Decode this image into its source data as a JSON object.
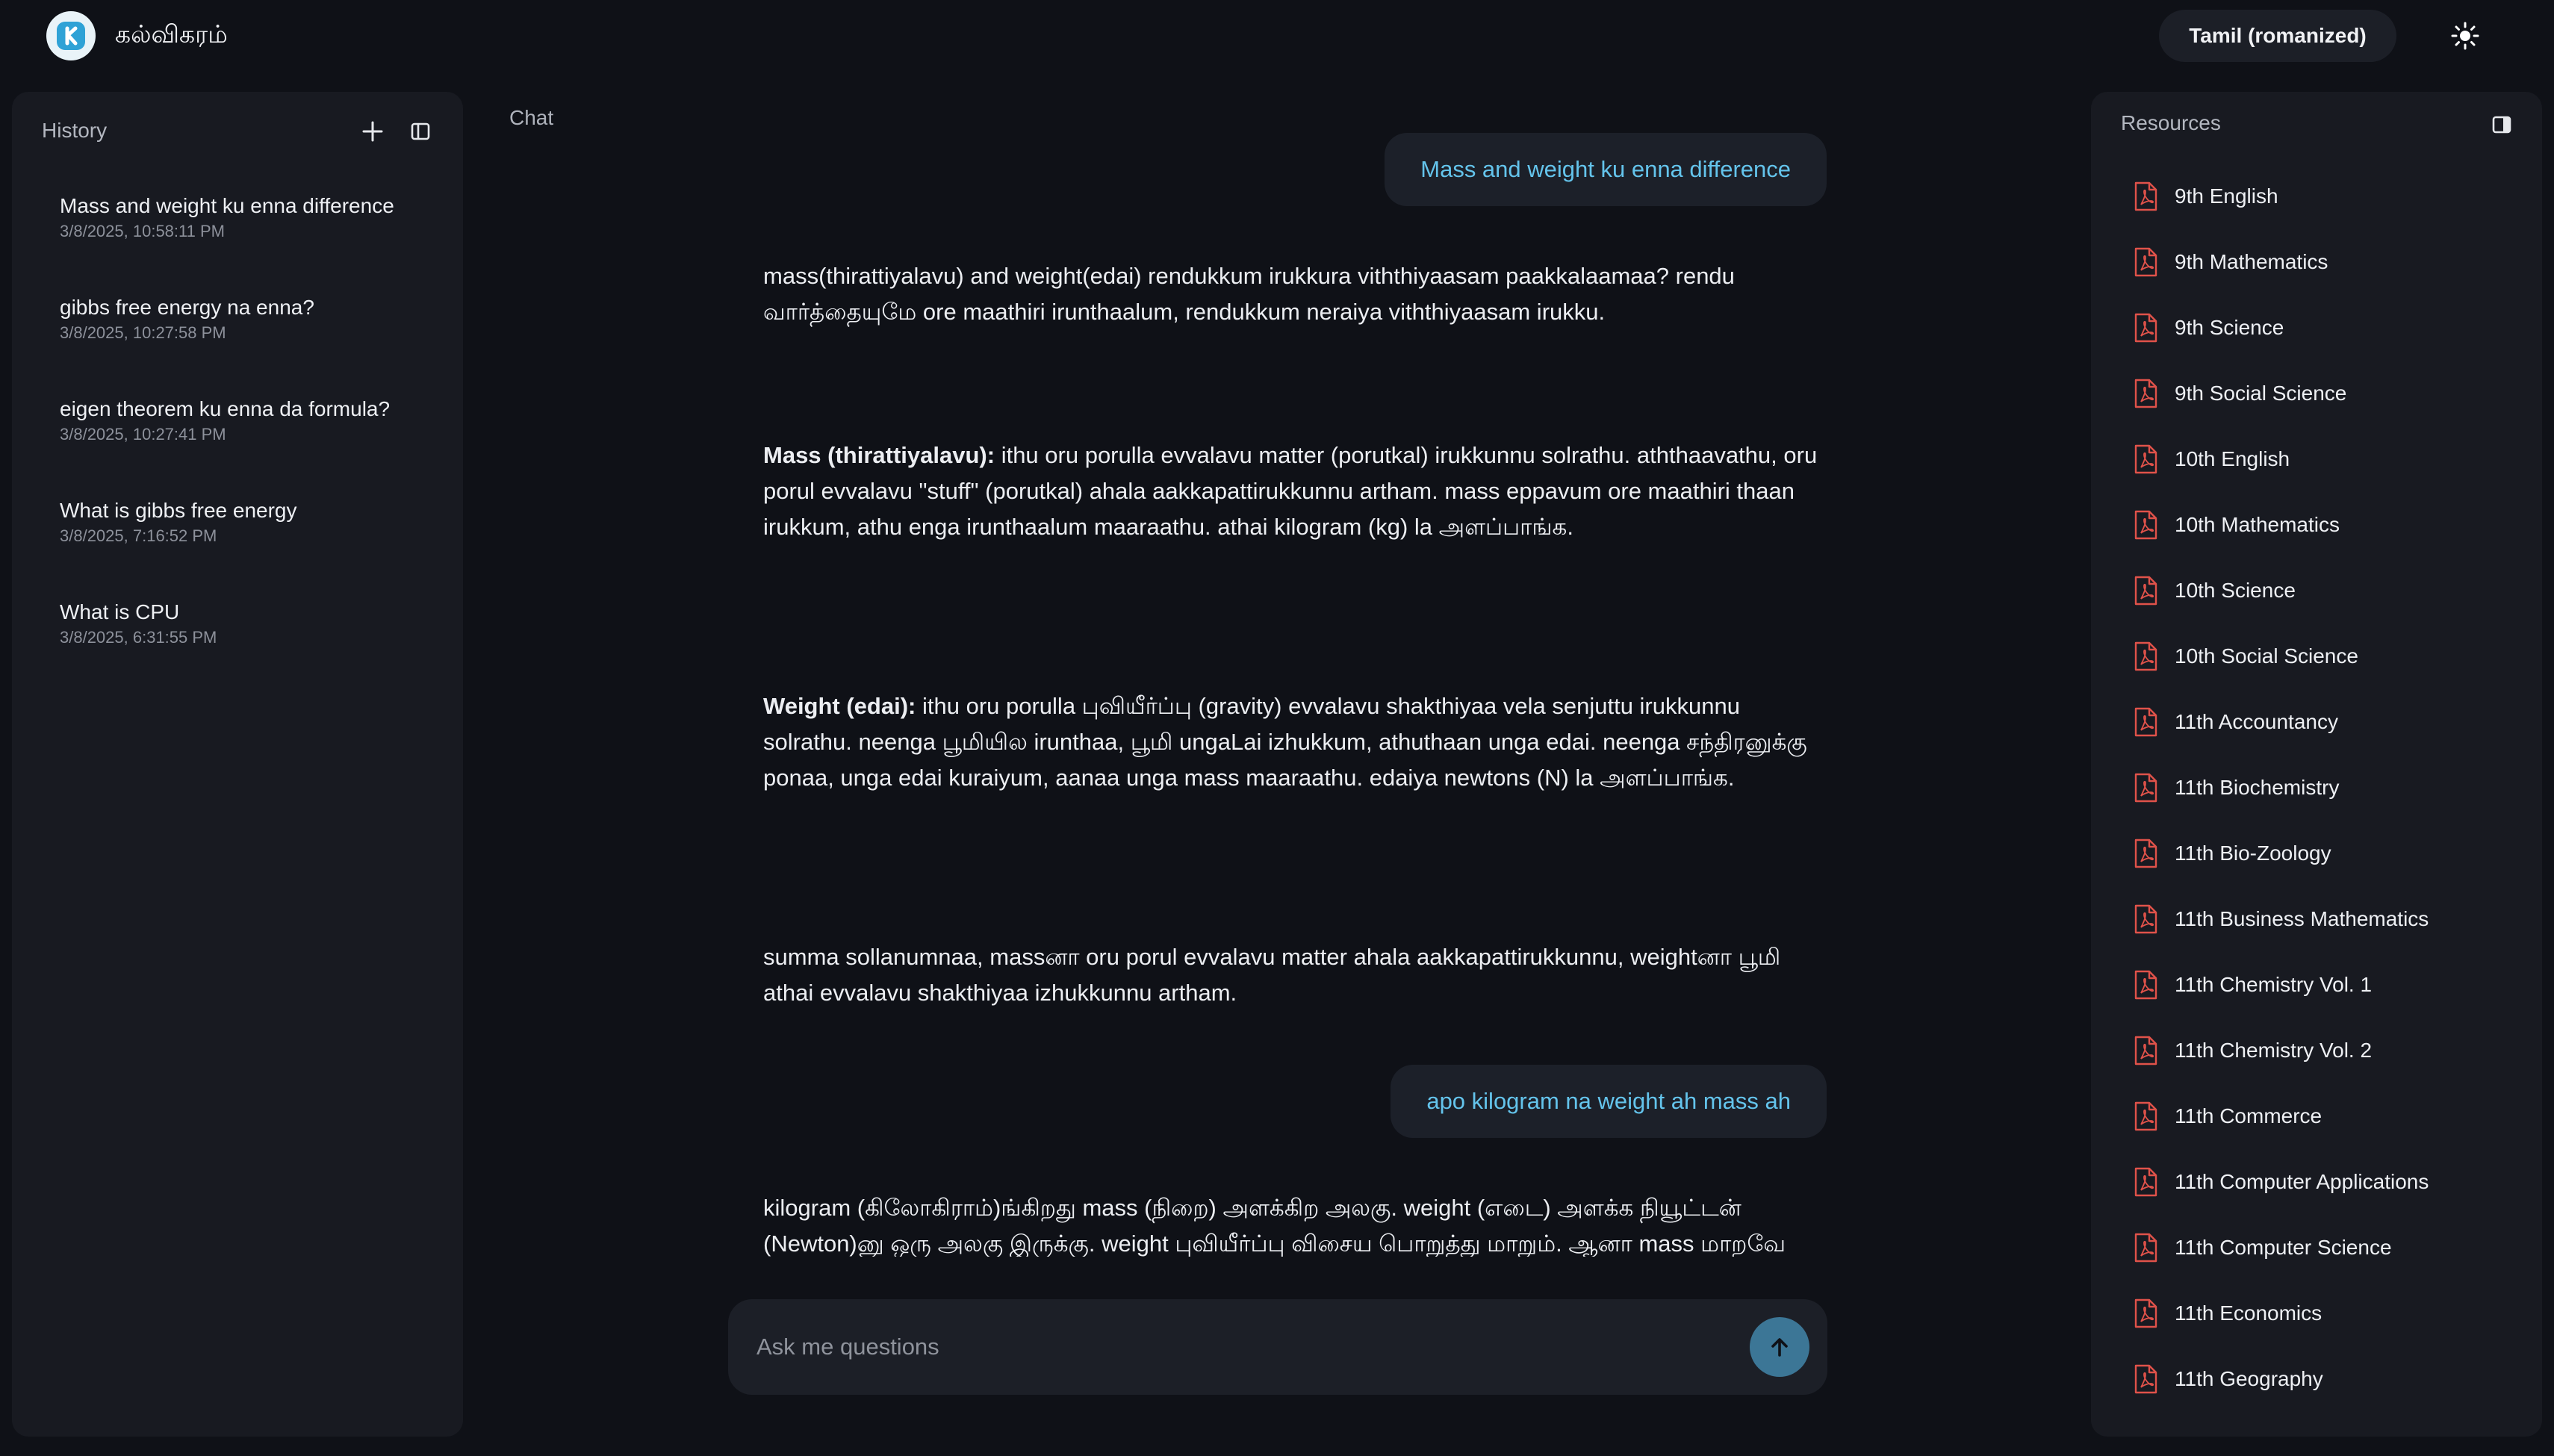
{
  "app": {
    "name": "கல்விகரம்",
    "language_button": "Tamil (romanized)",
    "theme_icon": "sun-icon"
  },
  "sidebar": {
    "title": "History",
    "history": [
      {
        "title": "Mass and weight ku enna difference",
        "date": "3/8/2025, 10:58:11 PM"
      },
      {
        "title": "gibbs free energy na enna?",
        "date": "3/8/2025, 10:27:58 PM"
      },
      {
        "title": "eigen theorem ku enna da formula?",
        "date": "3/8/2025, 10:27:41 PM"
      },
      {
        "title": "What is gibbs free energy",
        "date": "3/8/2025, 7:16:52 PM"
      },
      {
        "title": "What is CPU",
        "date": "3/8/2025, 6:31:55 PM"
      }
    ]
  },
  "chat": {
    "label": "Chat",
    "messages": [
      {
        "role": "user",
        "text": "Mass and weight ku enna difference"
      },
      {
        "role": "assistant",
        "text": "mass(thirattiyalavu) and weight(edai) rendukkum irukkura viththiyaasam paakkalaamaa? rendu வார்த்தையுமே ore maathiri irunthaalum, rendukkum neraiya viththiyaasam irukku."
      },
      {
        "role": "assistant",
        "bold": "Mass (thirattiyalavu):",
        "text": " ithu oru porulla evvalavu matter (porutkal) irukkunnu solrathu. aththaavathu, oru porul evvalavu \"stuff\" (porutkal) ahala aakkapattirukkunnu artham. mass eppavum ore maathiri thaan irukkum, athu enga irunthaalum maaraathu. athai kilogram (kg) la அளப்பாங்க."
      },
      {
        "role": "assistant",
        "bold": "Weight (edai):",
        "text": " ithu oru porulla புவியீர்ப்பு (gravity) evvalavu shakthiyaa vela senjuttu irukkunnu solrathu. neenga பூமியில irunthaa, பூமி ungaLai izhukkum, athuthaan unga edai. neenga சந்திரனுக்கு ponaa, unga edai kuraiyum, aanaa unga mass maaraathu. edaiya newtons (N) la அளப்பாங்க."
      },
      {
        "role": "assistant",
        "text": "summa sollanumnaa, massனா oru porul evvalavu matter ahala aakkapattirukkunnu, weightனா பூமி athai evvalavu shakthiyaa izhukkunnu artham."
      },
      {
        "role": "user",
        "text": "apo kilogram na weight ah mass ah"
      },
      {
        "role": "assistant",
        "text": "kilogram (கிலோகிராம்)ங்கிறது mass (நிறை) அளக்கிற அலகு. weight (எடை) அளக்க நியூட்டன் (Newton)னு ஒரு அலகு இருக்கு. weight புவியீர்ப்பு விசைய பொறுத்து மாறும். ஆனா mass மாறவே"
      }
    ]
  },
  "input": {
    "placeholder": "Ask me questions",
    "value": ""
  },
  "resources": {
    "title": "Resources",
    "items": [
      "9th English",
      "9th Mathematics",
      "9th Science",
      "9th Social Science",
      "10th English",
      "10th Mathematics",
      "10th Science",
      "10th Social Science",
      "11th Accountancy",
      "11th Biochemistry",
      "11th Bio-Zoology",
      "11th Business Mathematics",
      "11th Chemistry Vol. 1",
      "11th Chemistry Vol. 2",
      "11th Commerce",
      "11th Computer Applications",
      "11th Computer Science",
      "11th Economics",
      "11th Geography"
    ]
  },
  "colors": {
    "background": "#0f1117",
    "panel": "#181a21",
    "user_text": "#64c4ec",
    "send_button": "#3c7696",
    "pdf_icon": "#e0524a"
  }
}
